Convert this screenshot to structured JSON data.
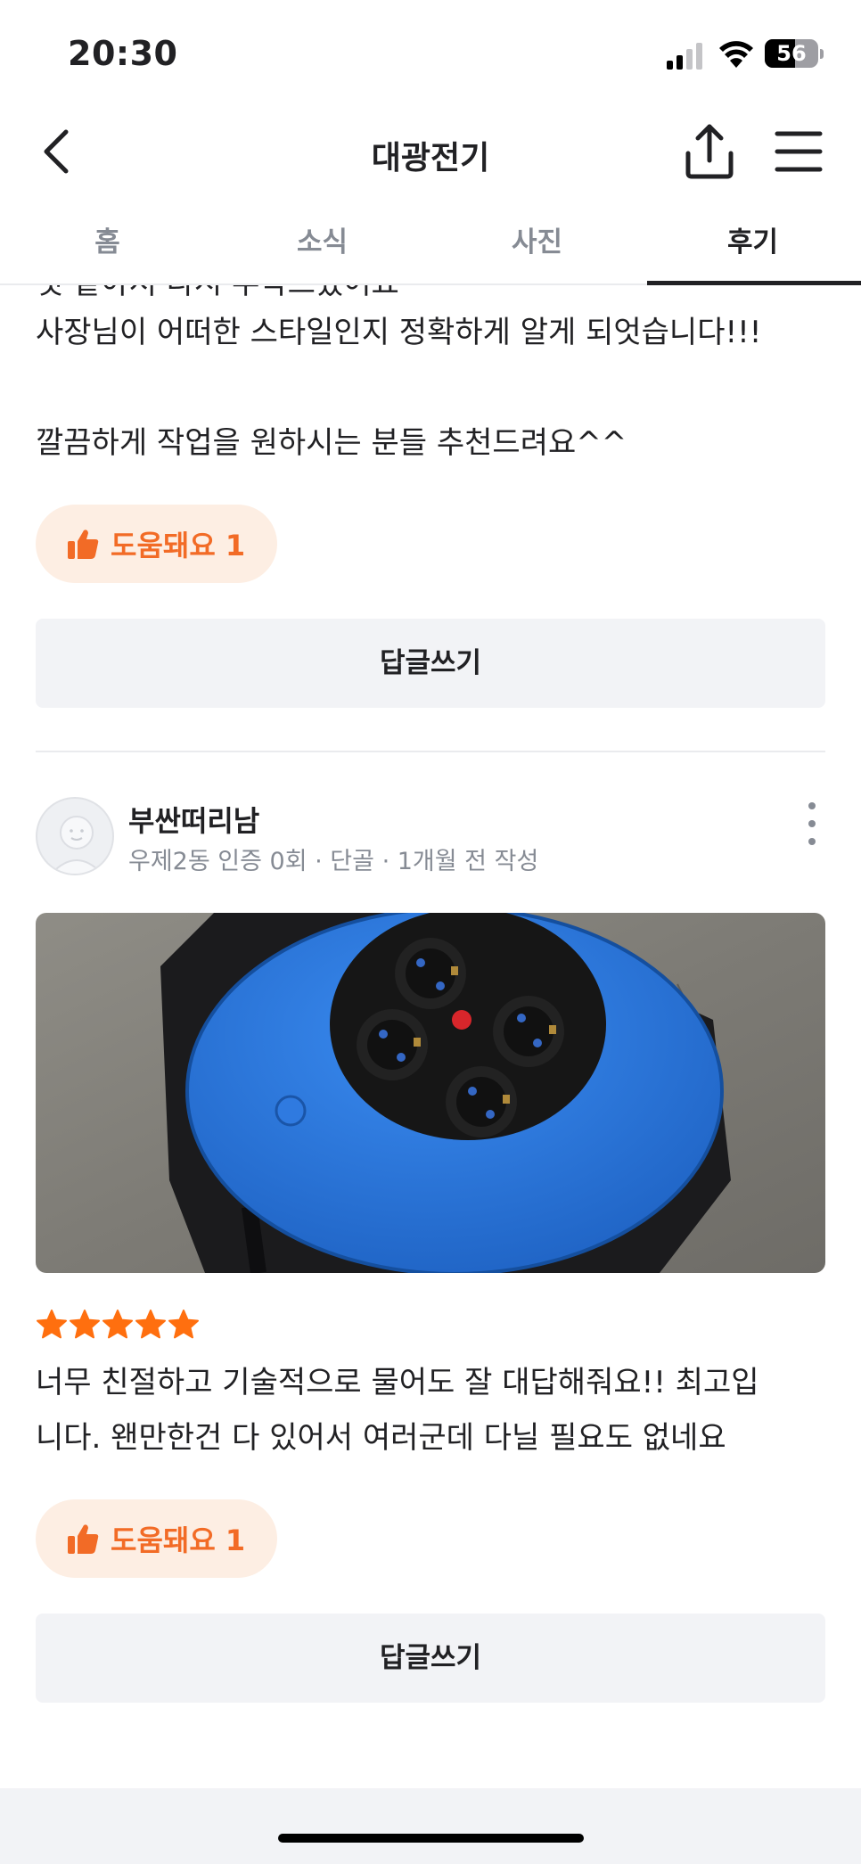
{
  "status_bar": {
    "time": "20:30",
    "battery": "56",
    "battery_level": 0.56
  },
  "header": {
    "title": "대광전기",
    "back_icon": "chevron-left-icon",
    "share_icon": "share-icon",
    "menu_icon": "hamburger-menu-icon"
  },
  "tabs": [
    {
      "label": "홈",
      "active": false
    },
    {
      "label": "소식",
      "active": false
    },
    {
      "label": "사진",
      "active": false
    },
    {
      "label": "후기",
      "active": true
    }
  ],
  "reviews": [
    {
      "clipped_text": "것 같아서 다시 부탁드렸어요",
      "text_lines": [
        "사장님이 어떠한 스타일인지 정확하게 알게 되엇습니다!!!",
        "",
        "깔끔하게 작업을 원하시는 분들 추천드려요^^"
      ],
      "helpful_label": "도움돼요 1",
      "reply_label": "답글쓰기"
    },
    {
      "author": "부싼떠리남",
      "meta": "우제2동 인증 0회 · 단골 · 1개월 전 작성",
      "rating": 5,
      "text_lines": [
        "너무 친절하고 기술적으로 물어도 잘 대답해줘요!! 최고입",
        "니다. 왠만한건 다 있어서 여러군데 다닐 필요도 없네요"
      ],
      "helpful_label": "도움돼요 1",
      "reply_label": "답글쓰기"
    }
  ],
  "colors": {
    "accent": "#f26b26",
    "helpful_bg": "#fdeee3",
    "reply_bg": "#f2f3f6",
    "star": "#ff6f0f",
    "reel_blue": "#2e7ce0"
  }
}
